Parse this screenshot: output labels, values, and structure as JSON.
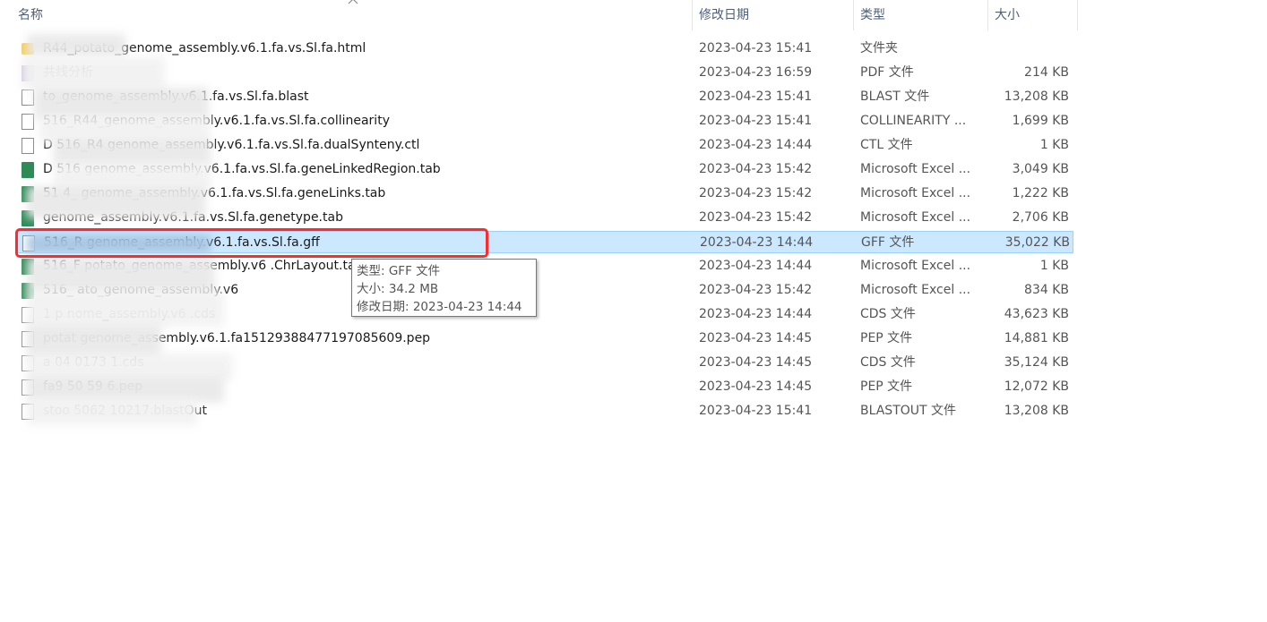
{
  "header": {
    "name": "名称",
    "date": "修改日期",
    "type": "类型",
    "size": "大小"
  },
  "files": [
    {
      "name": "R44_potato_genome_assembly.v6.1.fa.vs.Sl.fa.html",
      "date": "2023-04-23 15:41",
      "type": "文件夹",
      "size": "",
      "icon": "folder-icon"
    },
    {
      "name": "共线分析",
      "date": "2023-04-23 16:59",
      "type": "PDF 文件",
      "size": "214 KB",
      "icon": "pdf-icon"
    },
    {
      "name": "to_genome_assembly.v6.1.fa.vs.Sl.fa.blast",
      "date": "2023-04-23 15:41",
      "type": "BLAST 文件",
      "size": "13,208 KB",
      "icon": "file-icon"
    },
    {
      "name": "516_R44_genome_assembly.v6.1.fa.vs.Sl.fa.collinearity",
      "date": "2023-04-23 15:41",
      "type": "COLLINEARITY ...",
      "size": "1,699 KB",
      "icon": "file-icon"
    },
    {
      "name": "D 516_R4 genome_assembly.v6.1.fa.vs.Sl.fa.dualSynteny.ctl",
      "date": "2023-04-23 14:44",
      "type": "CTL 文件",
      "size": "1 KB",
      "icon": "file-icon"
    },
    {
      "name": "D 516 genome_assembly.v6.1.fa.vs.Sl.fa.geneLinkedRegion.tab",
      "date": "2023-04-23 15:42",
      "type": "Microsoft Excel ...",
      "size": "3,049 KB",
      "icon": "excel-icon"
    },
    {
      "name": "51 4_ genome_assembly.v6.1.fa.vs.Sl.fa.geneLinks.tab",
      "date": "2023-04-23 15:42",
      "type": "Microsoft Excel ...",
      "size": "1,222 KB",
      "icon": "excel-icon"
    },
    {
      "name": "genome_assembly.v6.1.fa.vs.Sl.fa.genetype.tab",
      "date": "2023-04-23 15:42",
      "type": "Microsoft Excel ...",
      "size": "2,706 KB",
      "icon": "excel-icon"
    },
    {
      "name": "516_R genome_assembly.v6.1.fa.vs.Sl.fa.gff",
      "date": "2023-04-23 14:44",
      "type": "GFF 文件",
      "size": "35,022 KB",
      "icon": "file-icon",
      "selected": true
    },
    {
      "name": "516_F potato_genome_assembly.v6 .ChrLayout.tab",
      "date": "2023-04-23 14:44",
      "type": "Microsoft Excel ...",
      "size": "1 KB",
      "icon": "excel-icon"
    },
    {
      "name": "516_ ato_genome_assembly.v6",
      "date": "2023-04-23 15:42",
      "type": "Microsoft Excel ...",
      "size": "834 KB",
      "icon": "excel-icon"
    },
    {
      "name": "1 p nome_assembly.v6 .cds",
      "date": "2023-04-23 14:44",
      "type": "CDS 文件",
      "size": "43,623 KB",
      "icon": "file-icon"
    },
    {
      "name": "potat genome_assembly.v6.1.fa15129388477197085609.pep",
      "date": "2023-04-23 14:45",
      "type": "PEP 文件",
      "size": "14,881 KB",
      "icon": "file-icon"
    },
    {
      "name": "a 04 0173 1.cds",
      "date": "2023-04-23 14:45",
      "type": "CDS 文件",
      "size": "35,124 KB",
      "icon": "file-icon"
    },
    {
      "name": "fa9 50 59 6.pep",
      "date": "2023-04-23 14:45",
      "type": "PEP 文件",
      "size": "12,072 KB",
      "icon": "file-icon"
    },
    {
      "name": "stoo 5062 10217.blastOut",
      "date": "2023-04-23 15:41",
      "type": "BLASTOUT 文件",
      "size": "13,208 KB",
      "icon": "file-icon"
    }
  ],
  "tooltip": {
    "type": "类型: GFF 文件",
    "size": "大小: 34.2 MB",
    "date": "修改日期: 2023-04-23 14:44"
  },
  "colors": {
    "selected_bg": "#cce8ff",
    "selected_border": "#99d1ff",
    "highlight": "#ff2b2b",
    "header_text": "#4c607a"
  }
}
